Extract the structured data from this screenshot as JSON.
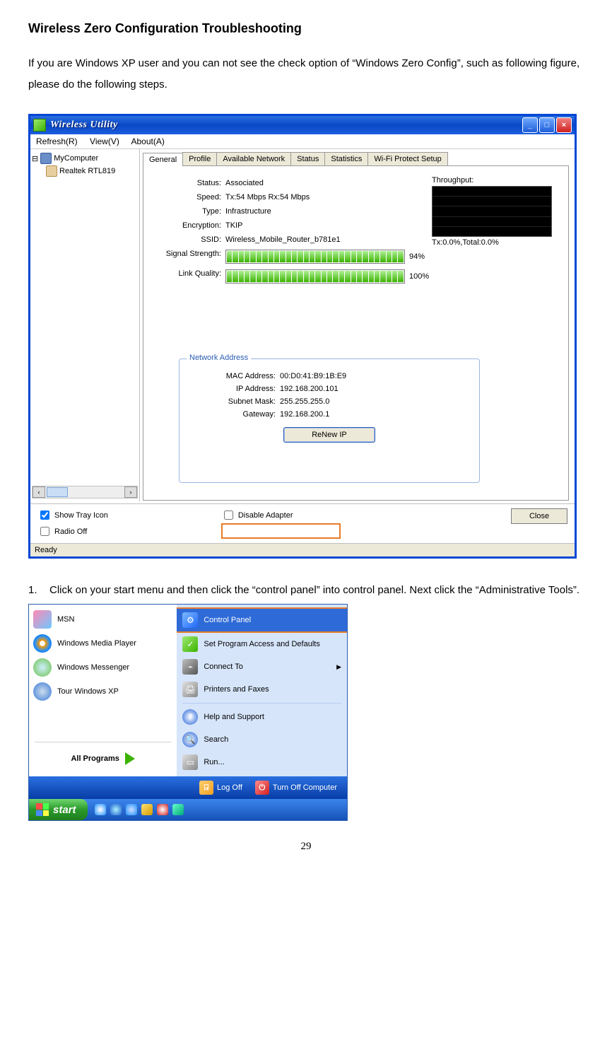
{
  "doc": {
    "heading": "Wireless Zero Configuration Troubleshooting",
    "intro": "If you are Windows XP user and you can not see the check option of “Windows Zero Config”, such as following figure, please do the following steps.",
    "step1_num": "1.",
    "step1_text": "Click on your start menu and then click the “control panel” into control panel. Next click the “Administrative Tools”.",
    "page_num": "29"
  },
  "win": {
    "title": "Wireless Utility",
    "menu_refresh": "Refresh(R)",
    "menu_view": "View(V)",
    "menu_about": "About(A)",
    "tree_root": "MyComputer",
    "tree_card": "Realtek RTL819",
    "tabs": {
      "general": "General",
      "profile": "Profile",
      "avail": "Available Network",
      "status": "Status",
      "stats": "Statistics",
      "wps": "Wi-Fi Protect Setup"
    },
    "labels": {
      "status": "Status:",
      "speed": "Speed:",
      "type": "Type:",
      "encryption": "Encryption:",
      "ssid": "SSID:",
      "signal": "Signal Strength:",
      "link": "Link Quality:",
      "throughput": "Throughput:",
      "network_addr": "Network Address",
      "mac": "MAC Address:",
      "ip": "IP Address:",
      "subnet": "Subnet Mask:",
      "gateway": "Gateway:"
    },
    "values": {
      "status": "Associated",
      "speed": "Tx:54 Mbps Rx:54 Mbps",
      "type": "Infrastructure",
      "encryption": "TKIP",
      "ssid": "Wireless_Mobile_Router_b781e1",
      "signal_pct": "94%",
      "link_pct": "100%",
      "throughput_txt": "Tx:0.0%,Total:0.0%",
      "mac": "00:D0:41:B9:1B:E9",
      "ip": "192.168.200.101",
      "subnet": "255.255.255.0",
      "gateway": "192.168.200.1"
    },
    "buttons": {
      "renew": "ReNew IP",
      "close": "Close"
    },
    "checks": {
      "tray": "Show Tray Icon",
      "radio": "Radio Off",
      "disable": "Disable Adapter"
    },
    "statusbar": "Ready"
  },
  "start": {
    "left": {
      "msn": "MSN",
      "wmp": "Windows Media Player",
      "msgr": "Windows Messenger",
      "tour": "Tour Windows XP",
      "allprog": "All Programs"
    },
    "right": {
      "cp": "Control Panel",
      "spa": "Set Program Access and Defaults",
      "conn": "Connect To",
      "pf": "Printers and Faxes",
      "help": "Help and Support",
      "search": "Search",
      "run": "Run..."
    },
    "bottom": {
      "logoff": "Log Off",
      "turnoff": "Turn Off Computer"
    },
    "startbtn": "start"
  }
}
